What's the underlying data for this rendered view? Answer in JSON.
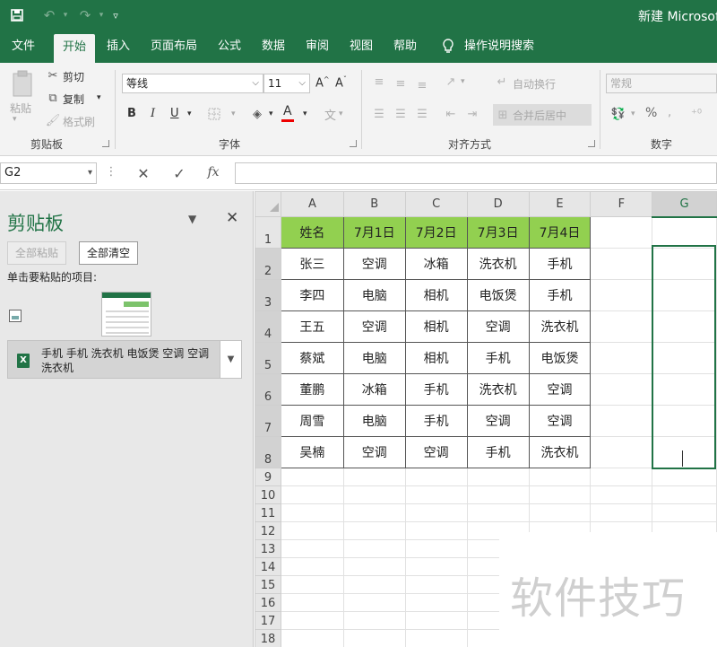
{
  "window": {
    "title": "新建 Microsoft"
  },
  "quick_access": [
    "save-icon",
    "undo-icon",
    "redo-icon",
    "customize-icon"
  ],
  "tabs": [
    "文件",
    "开始",
    "插入",
    "页面布局",
    "公式",
    "数据",
    "审阅",
    "视图",
    "帮助",
    "操作说明搜索"
  ],
  "active_tab": "开始",
  "ribbon": {
    "clipboard": {
      "label": "剪贴板",
      "paste": "粘贴",
      "cut": "剪切",
      "copy": "复制",
      "format_painter": "格式刷"
    },
    "font": {
      "label": "字体",
      "font_name": "等线",
      "font_size": "11",
      "bold": "B",
      "italic": "I",
      "underline": "U"
    },
    "alignment": {
      "label": "对齐方式",
      "wrap": "自动换行",
      "merge": "合并后居中"
    },
    "number": {
      "label": "数字",
      "format": "常规",
      "percent": "%"
    }
  },
  "formula_bar": {
    "name_box": "G2",
    "cancel": "✕",
    "enter": "✓",
    "fx": "fx",
    "value": ""
  },
  "clipboard_pane": {
    "title": "剪贴板",
    "paste_all": "全部粘贴",
    "clear_all": "全部清空",
    "hint": "单击要粘贴的项目:",
    "item_text": "手机 手机 洗衣机 电饭煲 空调 空调 洗衣机"
  },
  "sheet": {
    "columns": [
      "A",
      "B",
      "C",
      "D",
      "E",
      "F",
      "G"
    ],
    "selected_column": "G",
    "header_row": [
      "姓名",
      "7月1日",
      "7月2日",
      "7月3日",
      "7月4日"
    ],
    "rows": [
      [
        "张三",
        "空调",
        "冰箱",
        "洗衣机",
        "手机"
      ],
      [
        "李四",
        "电脑",
        "相机",
        "电饭煲",
        "手机"
      ],
      [
        "王五",
        "空调",
        "相机",
        "空调",
        "洗衣机"
      ],
      [
        "蔡斌",
        "电脑",
        "相机",
        "手机",
        "电饭煲"
      ],
      [
        "董鹏",
        "冰箱",
        "手机",
        "洗衣机",
        "空调"
      ],
      [
        "周雪",
        "电脑",
        "手机",
        "空调",
        "空调"
      ],
      [
        "吴楠",
        "空调",
        "空调",
        "手机",
        "洗衣机"
      ]
    ],
    "row_numbers": [
      "1",
      "2",
      "3",
      "4",
      "5",
      "6",
      "7",
      "8",
      "9",
      "10",
      "11",
      "12",
      "13",
      "14",
      "15",
      "16",
      "17",
      "18"
    ],
    "accent_color": "#217346",
    "header_fill": "#92d050"
  },
  "watermark": "软件技巧"
}
